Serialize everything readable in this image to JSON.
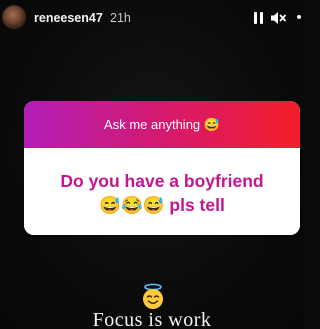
{
  "header": {
    "username": "reneesen47",
    "time_ago": "21h",
    "avatar_icon": "avatar",
    "pause_icon": "pause-icon",
    "mute_icon": "mute-icon",
    "more_icon": "more-icon"
  },
  "sticker": {
    "prompt": "Ask me anything 😅",
    "question_line1": "Do you have a boyfriend",
    "question_line2": "😅😂😅 pls tell",
    "gradient_colors": [
      "#b21fb7",
      "#d5196f",
      "#f21f2a"
    ],
    "question_color": "#c4168e"
  },
  "story": {
    "caption_emoji": "😇",
    "caption_emoji_icon": "smiling-face-with-halo-icon",
    "caption": "Focus is work"
  }
}
